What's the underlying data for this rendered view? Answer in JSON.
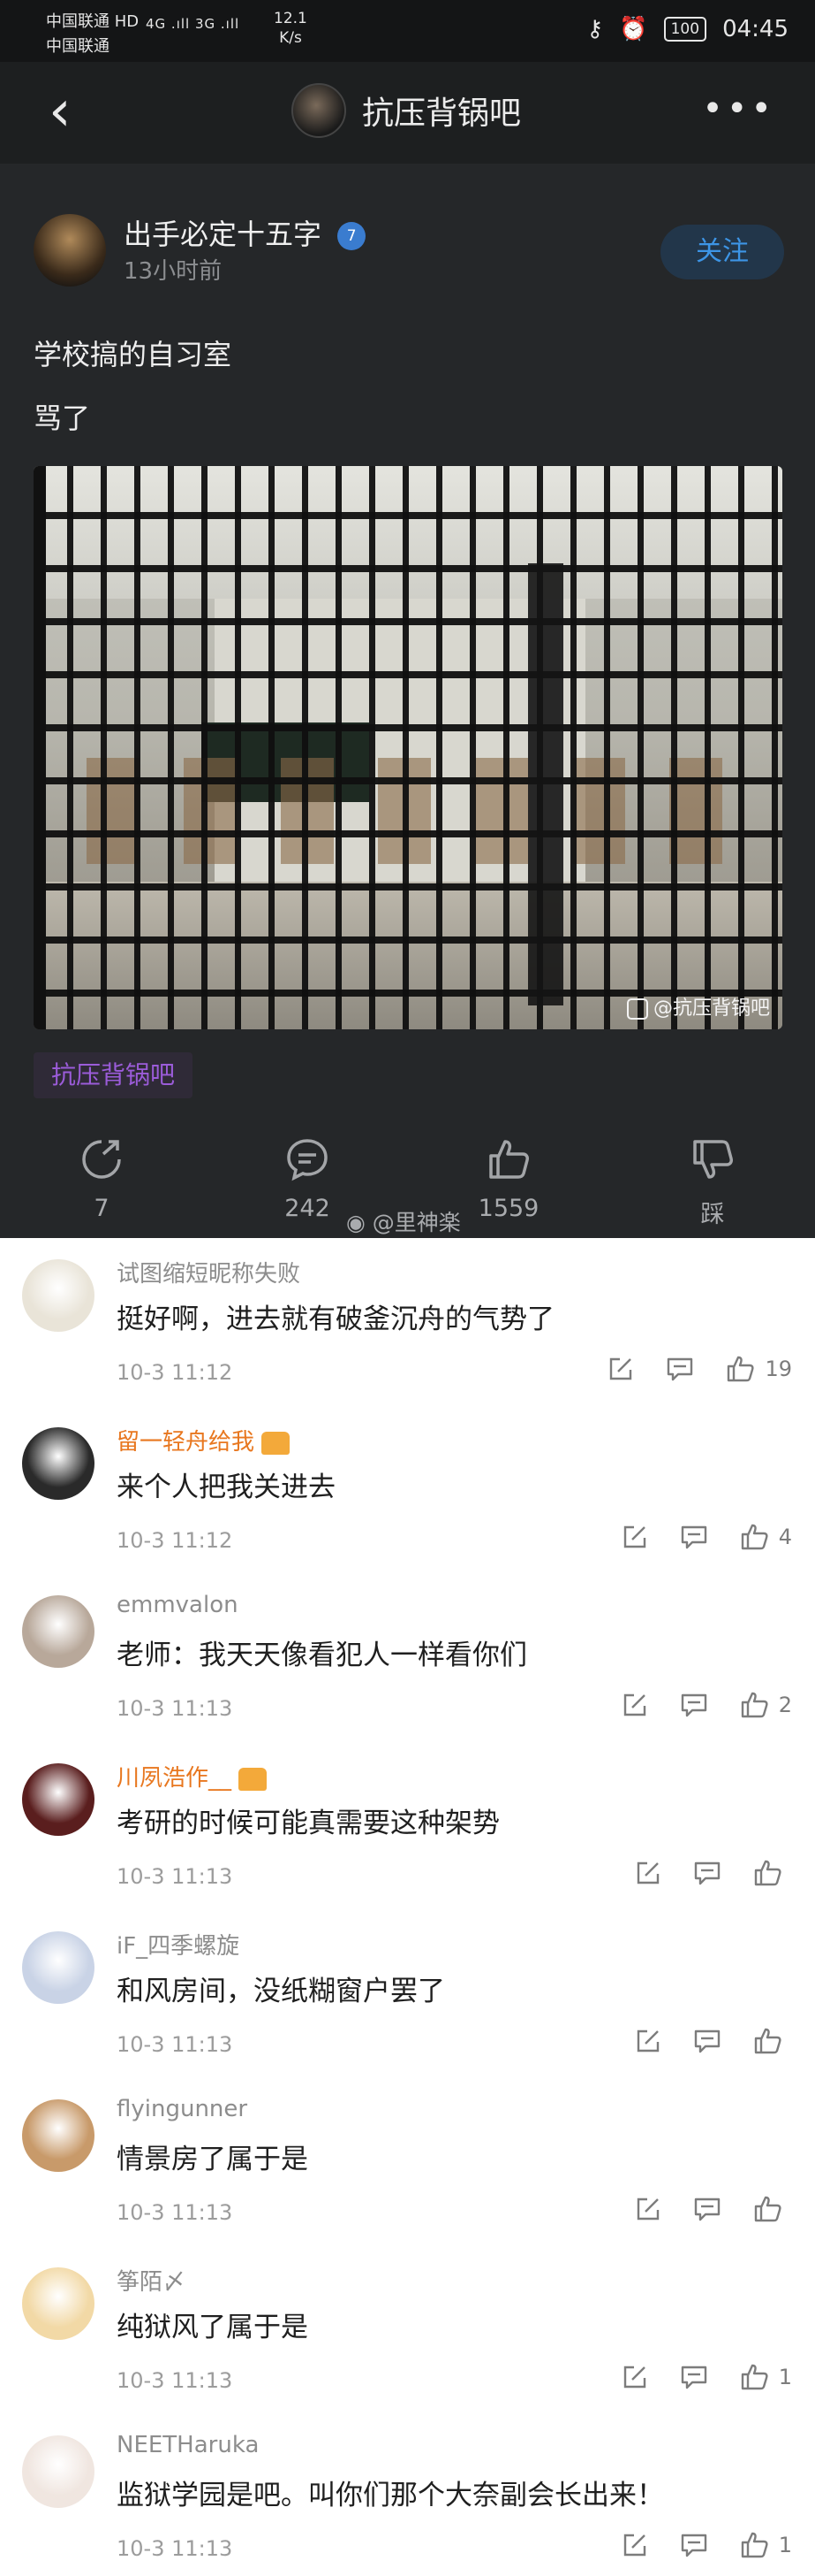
{
  "status_bar": {
    "carrier1": "中国联通 HD",
    "carrier2": "中国联通",
    "network": "4G .ıll 3G .ıll",
    "speed": "12.1",
    "speed_unit": "K/s",
    "battery": "100",
    "time": "04:45"
  },
  "nav": {
    "title": "抗压背锅吧",
    "more_icon": "more-dots-icon",
    "back_icon": "back-arrow-icon"
  },
  "post": {
    "username": "出手必定十五字",
    "badge": "7",
    "time": "13小时前",
    "follow_label": "关注",
    "title": "学校搞的自习室",
    "body": "骂了",
    "image_watermark": "@抗压背锅吧",
    "tag": "抗压背锅吧",
    "actions": {
      "share_count": "7",
      "comment_count": "242",
      "like_count": "1559",
      "dislike_label": "踩"
    },
    "weibo_watermark": "@里神楽"
  },
  "comments": [
    {
      "name": "试图缩短昵称失败",
      "vip": false,
      "text": "挺好啊，进去就有破釜沉舟的气势了",
      "time": "10-3 11:12",
      "likes": "19",
      "avatar_color": "#e9e4d8"
    },
    {
      "name": "留一轻舟给我",
      "vip": true,
      "text": "来个人把我关进去",
      "time": "10-3 11:12",
      "likes": "4",
      "avatar_color": "#2a2a2a"
    },
    {
      "name": "emmvalon",
      "vip": false,
      "text": "老师：我天天像看犯人一样看你们",
      "time": "10-3 11:13",
      "likes": "2",
      "avatar_color": "#b8a89a"
    },
    {
      "name": "川夙浩作__",
      "vip": true,
      "text": "考研的时候可能真需要这种架势",
      "time": "10-3 11:13",
      "likes": "",
      "avatar_color": "#5a1e1e"
    },
    {
      "name": "iF_四季螺旋",
      "vip": false,
      "text": "和风房间，没纸糊窗户罢了",
      "time": "10-3 11:13",
      "likes": "",
      "avatar_color": "#c9d3e6"
    },
    {
      "name": "flyingunner",
      "vip": false,
      "text": "情景房了属于是",
      "time": "10-3 11:13",
      "likes": "",
      "avatar_color": "#c89a6a"
    },
    {
      "name": "筝陌〆",
      "vip": false,
      "text": "纯狱风了属于是",
      "time": "10-3 11:13",
      "likes": "1",
      "avatar_color": "#f2d9a6"
    },
    {
      "name": "NEETHaruka",
      "vip": false,
      "text": "监狱学园是吧。叫你们那个大奈副会长出来！",
      "time": "10-3 11:13",
      "likes": "1",
      "avatar_color": "#f0e6e0"
    }
  ],
  "colors": {
    "dark_bg": "#252729",
    "follow_text": "#3d95e6",
    "tag_text": "#9b5cd9",
    "vip_name": "#e8771f"
  }
}
